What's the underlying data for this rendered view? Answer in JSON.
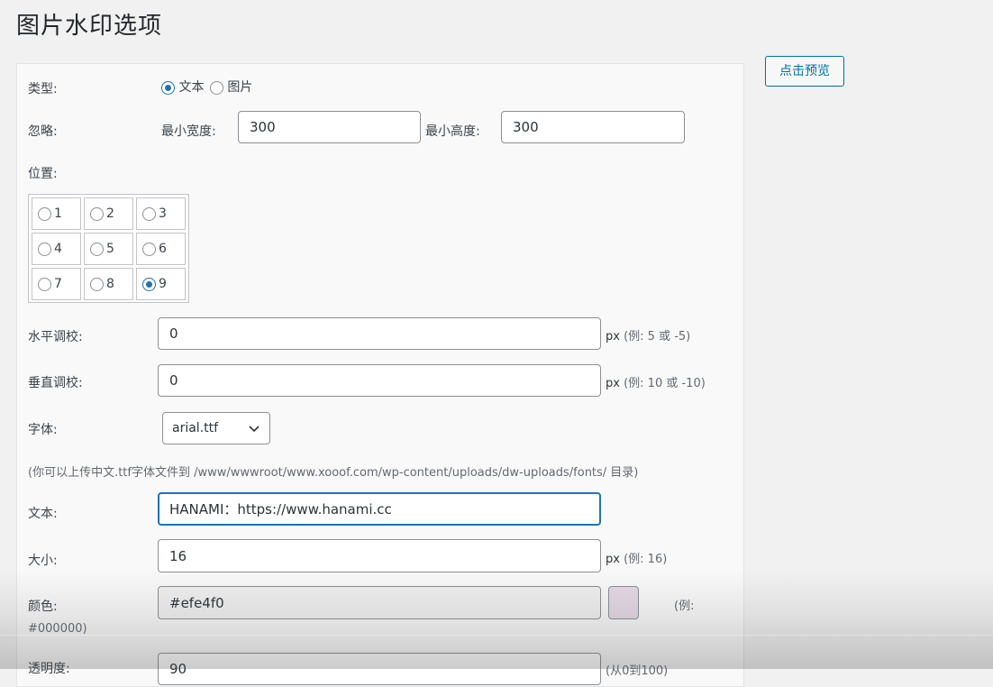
{
  "page": {
    "title": "图片水印选项",
    "preview_button": "点击预览"
  },
  "type_row": {
    "label": "类型:",
    "options": [
      "文本",
      "图片"
    ],
    "selected": "文本"
  },
  "ignore_row": {
    "label": "忽略:",
    "min_width_label": "最小宽度:",
    "min_width_value": "300",
    "min_height_label": "最小高度:",
    "min_height_value": "300"
  },
  "position_row": {
    "label": "位置:",
    "cells": [
      "1",
      "2",
      "3",
      "4",
      "5",
      "6",
      "7",
      "8",
      "9"
    ],
    "selected": "9"
  },
  "h_offset": {
    "label": "水平调校:",
    "value": "0",
    "unit": "px",
    "example": "(例:  5 或 -5)"
  },
  "v_offset": {
    "label": "垂直调校:",
    "value": "0",
    "unit": "px",
    "example": "(例:  10 或 -10)"
  },
  "font": {
    "label": "字体:",
    "value": "arial.ttf",
    "note": "(你可以上传中文.ttf字体文件到 /www/wwwroot/www.xooof.com/wp-content/uploads/dw-uploads/fonts/ 目录)"
  },
  "text": {
    "label": "文本:",
    "value": "HANAMI：https://www.hanami.cc"
  },
  "size": {
    "label": "大小:",
    "value": "16",
    "unit": "px",
    "example": "(例:  16)"
  },
  "color": {
    "label": "颜色:",
    "value": "#efe4f0",
    "swatch": "#e4d9e5",
    "example": "(例:",
    "example_cont": "#000000)"
  },
  "opacity": {
    "label": "透明度:",
    "value": "90",
    "example": "(从0到100)"
  },
  "colors": {
    "accent": "#2271b1",
    "button_border": "#0071a1"
  }
}
